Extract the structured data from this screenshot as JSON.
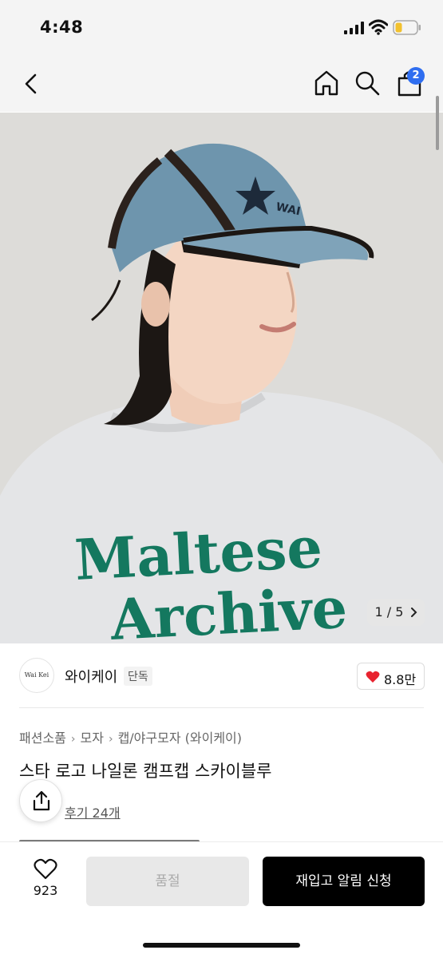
{
  "status_bar": {
    "time": "4:48"
  },
  "nav": {
    "cart_count": "2"
  },
  "gallery": {
    "counter": "1 / 5",
    "print_line1": "Maltese",
    "print_line2": "Archive"
  },
  "brand": {
    "name": "와이케이",
    "logo_text": "Wai Kei",
    "badge": "단독",
    "like_count": "8.8만"
  },
  "breadcrumb": {
    "items": [
      "패션소품",
      "모자",
      "캡/야구모자 (와이케이)"
    ]
  },
  "product": {
    "title": "스타 로고 나일론 캠프캡 스카이블루",
    "review_text": "후기 24개"
  },
  "bottom": {
    "wish_count": "923",
    "soldout_label": "품절",
    "restock_label": "재입고 알림 신청"
  },
  "colors": {
    "accent_badge": "#2f6ef0",
    "heart": "#e8232f",
    "primary_button": "#000000",
    "disabled_button": "#e8e8e8",
    "cap": "#6e95ad",
    "print_green": "#14785f"
  },
  "icons": [
    "back-icon",
    "home-icon",
    "search-icon",
    "shopping-bag-icon",
    "heart-icon",
    "share-icon",
    "chevron-right-icon"
  ]
}
